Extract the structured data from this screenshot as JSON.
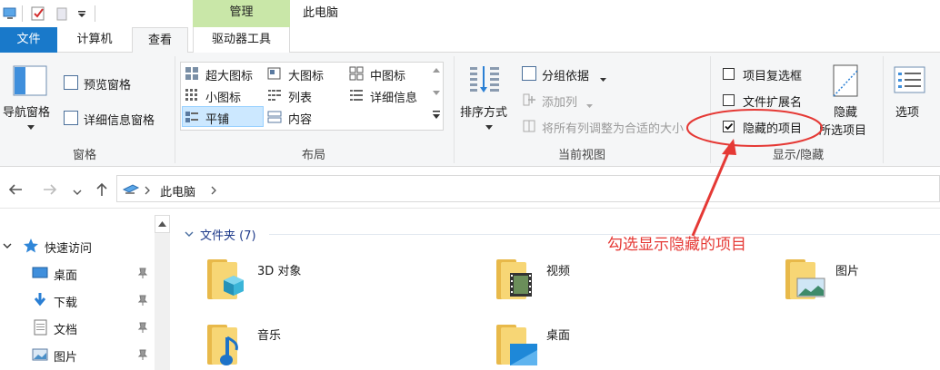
{
  "window": {
    "title": "此电脑",
    "contextual_tab": "管理"
  },
  "tabs": {
    "file": "文件",
    "computer": "计算机",
    "view": "查看",
    "drive_tools": "驱动器工具"
  },
  "ribbon": {
    "panes": {
      "nav_pane": "导航窗格",
      "preview_pane": "预览窗格",
      "details_pane": "详细信息窗格",
      "group_label": "窗格"
    },
    "layout": {
      "items": [
        "超大图标",
        "大图标",
        "中图标",
        "小图标",
        "列表",
        "详细信息",
        "平铺",
        "内容"
      ],
      "selected": "平铺",
      "group_label": "布局"
    },
    "current_view": {
      "sort_by": "排序方式",
      "group_by": "分组依据",
      "add_column": "添加列",
      "fit_columns": "将所有列调整为合适的大小",
      "group_label": "当前视图"
    },
    "show_hide": {
      "item_checkboxes": {
        "label": "项目复选框",
        "checked": false
      },
      "file_extensions": {
        "label": "文件扩展名",
        "checked": false
      },
      "hidden_items": {
        "label": "隐藏的项目",
        "checked": true
      },
      "hide_selected_line1": "隐藏",
      "hide_selected_line2": "所选项目",
      "group_label": "显示/隐藏"
    },
    "options": "选项"
  },
  "address": {
    "location": "此电脑"
  },
  "nav_pane": {
    "quick_access": "快速访问",
    "items": [
      {
        "label": "桌面",
        "icon": "desktop-icon"
      },
      {
        "label": "下载",
        "icon": "download-icon"
      },
      {
        "label": "文档",
        "icon": "document-icon"
      },
      {
        "label": "图片",
        "icon": "picture-icon"
      }
    ]
  },
  "content": {
    "section_header": "文件夹 (7)",
    "folders": [
      "3D 对象",
      "视频",
      "图片",
      "音乐",
      "桌面"
    ]
  },
  "annotation": {
    "text": "勾选显示隐藏的项目",
    "color": "#e53935"
  },
  "colors": {
    "file_tab": "#1979ca",
    "manage_tab": "#c9e7a8",
    "selection": "#cce8ff",
    "folder": "#f7d675"
  }
}
